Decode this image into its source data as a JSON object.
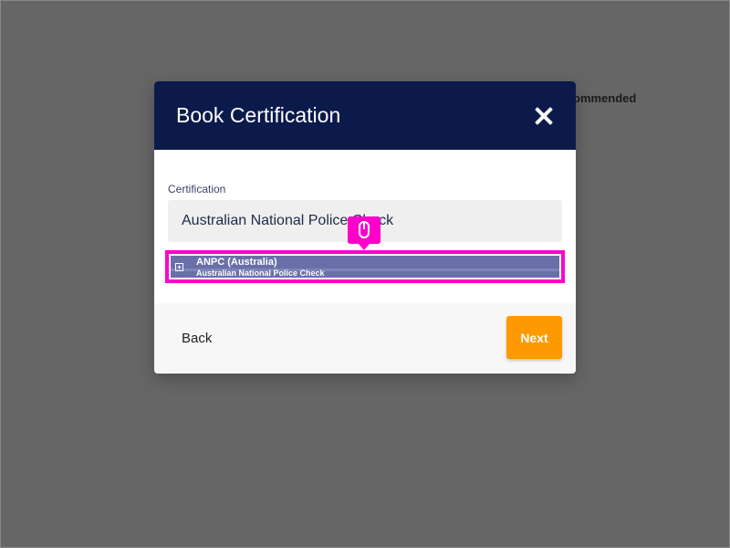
{
  "background": {
    "partial_text": "ommended"
  },
  "modal": {
    "title": "Book Certification",
    "close_icon": "close-icon",
    "field_label": "Certification",
    "input_value": "Australian National Police Check",
    "suggestion": {
      "title": "ANPC (Australia)",
      "subtitle": "Australian National Police Check",
      "icon": "expand-icon"
    },
    "footer": {
      "back_label": "Back",
      "next_label": "Next"
    }
  },
  "colors": {
    "header": "#0b1a4b",
    "accent": "#ff9900",
    "highlight": "#ff00cc",
    "suggestion_bg": "#6a6fa8"
  }
}
